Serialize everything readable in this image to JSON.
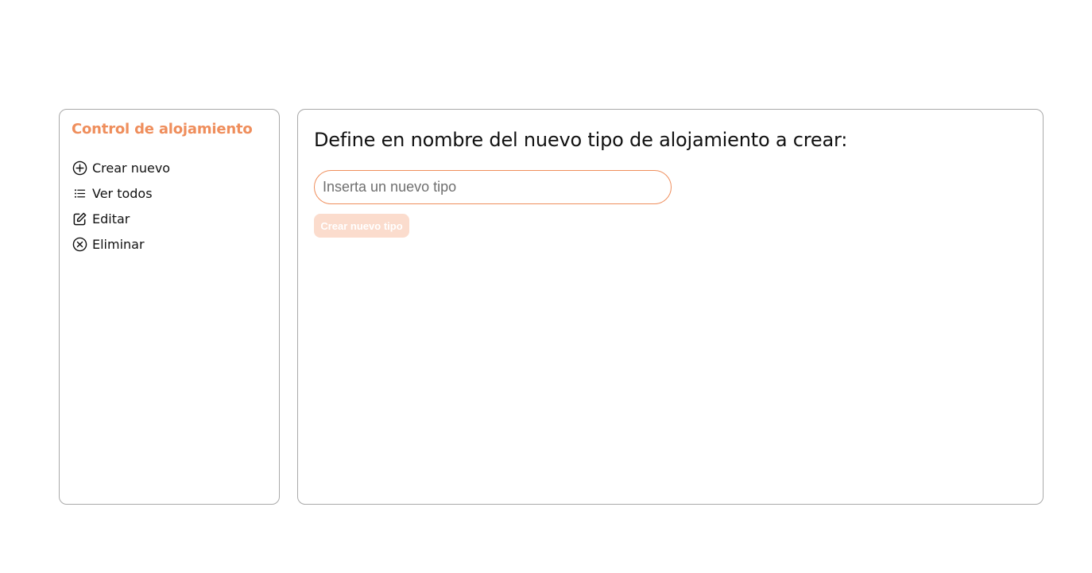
{
  "sidebar": {
    "title": "Control de alojamiento",
    "items": [
      {
        "label": "Crear nuevo",
        "icon": "plus-circle-icon"
      },
      {
        "label": "Ver todos",
        "icon": "list-icon"
      },
      {
        "label": "Editar",
        "icon": "edit-icon"
      },
      {
        "label": "Eliminar",
        "icon": "x-circle-icon"
      }
    ]
  },
  "main": {
    "heading": "Define en nombre del nuevo tipo de alojamiento a crear:",
    "input": {
      "placeholder": "Inserta un nuevo tipo",
      "value": ""
    },
    "submit_label": "Crear nuevo tipo"
  },
  "colors": {
    "accent": "#ef8e5c",
    "button_disabled_bg": "#fbdccd",
    "border": "#a9a9a9"
  }
}
